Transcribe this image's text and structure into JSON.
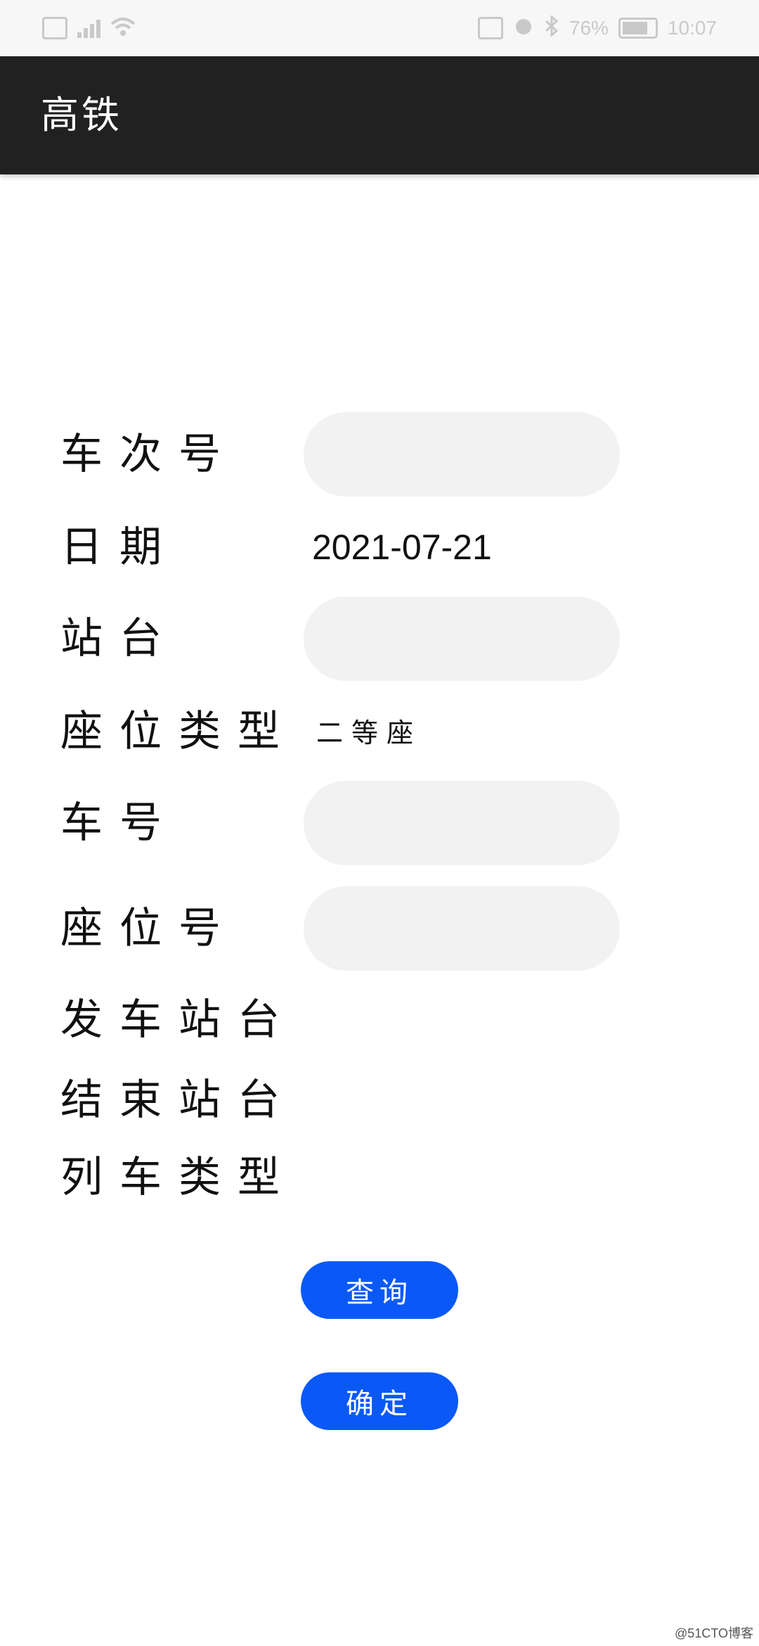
{
  "status_bar": {
    "battery_text": "76%",
    "time": "10:07"
  },
  "app_bar": {
    "title": "高铁"
  },
  "form": {
    "train_number_label": "车次号",
    "date_label": "日期",
    "date_value": "2021-07-21",
    "station_label": "站台",
    "seat_type_label": "座位类型",
    "seat_type_value": "二等座",
    "car_number_label": "车号",
    "seat_number_label": "座位号",
    "departure_station_label": "发车站台",
    "end_station_label": "结束站台",
    "train_type_label": "列车类型"
  },
  "buttons": {
    "query_label": "查询",
    "confirm_label": "确定"
  },
  "watermark": "@51CTO博客",
  "colors": {
    "app_bar": "#212121",
    "button": "#0a59f7",
    "field_bg": "#f2f2f2"
  }
}
